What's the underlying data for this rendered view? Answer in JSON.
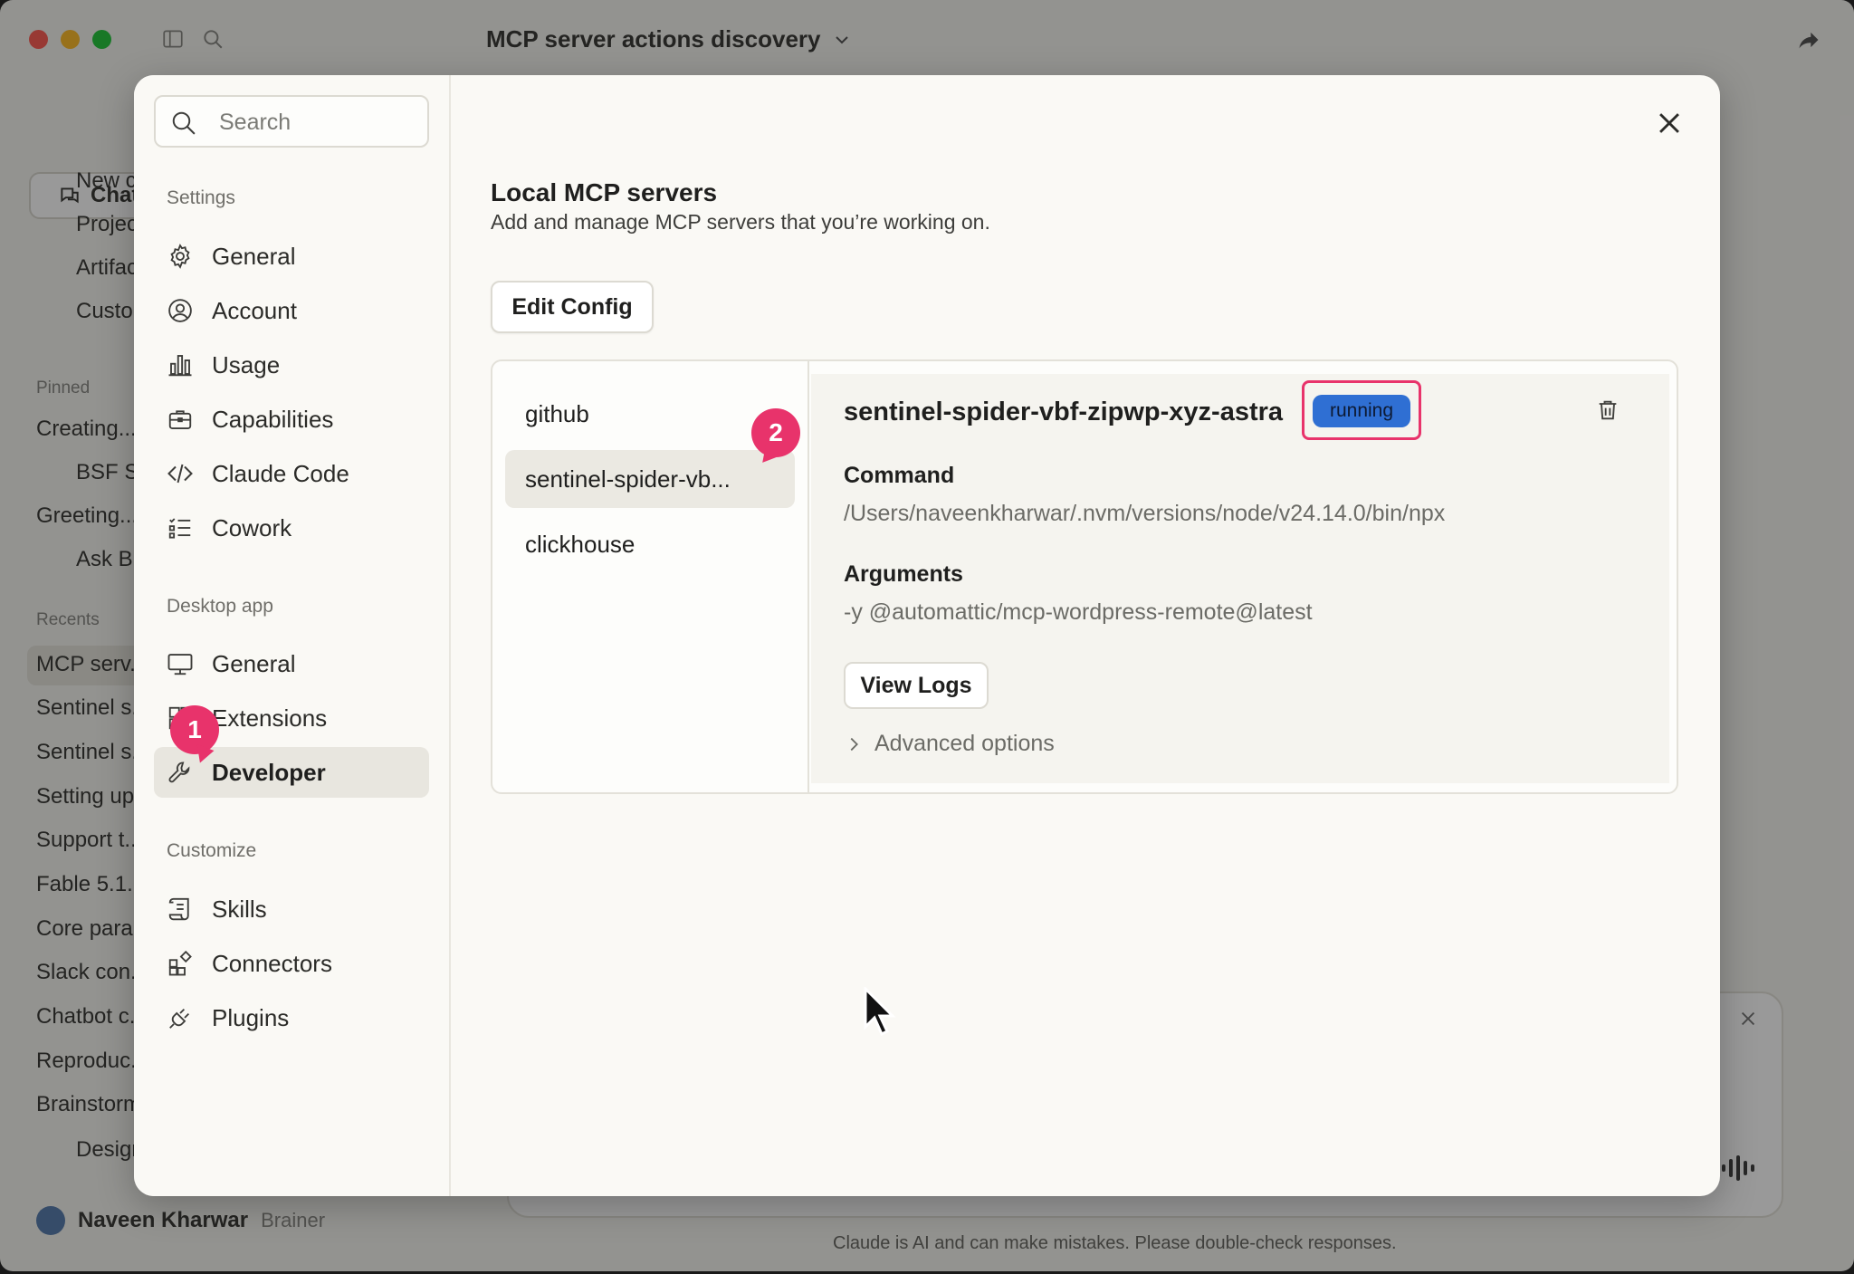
{
  "background": {
    "chat_title": "MCP server actions discovery",
    "chat_button": "Chat",
    "sidebar_items": [
      "New chat",
      "Projects",
      "Artifacts",
      "Customize"
    ],
    "pinned_label": "Pinned",
    "pinned_items": [
      "Creating...",
      "BSF S...",
      "Greeting...",
      "Ask B..."
    ],
    "recents_label": "Recents",
    "recent_items": [
      "MCP serv...",
      "Sentinel s...",
      "Sentinel s...",
      "Setting up...",
      "Support t...",
      "Fable 5.1...",
      "Core para...",
      "Slack con...",
      "Chatbot c...",
      "Reproduc...",
      "Brainstorm...",
      "Design..."
    ],
    "user_name": "Naveen Kharwar",
    "user_plan": "Brainer",
    "disclaimer": "Claude is AI and can make mistakes. Please double-check responses."
  },
  "nav": {
    "search_placeholder": "Search",
    "settings_label": "Settings",
    "settings_items": [
      {
        "label": "General",
        "icon": "gear-icon"
      },
      {
        "label": "Account",
        "icon": "account-icon"
      },
      {
        "label": "Usage",
        "icon": "usage-icon"
      },
      {
        "label": "Capabilities",
        "icon": "briefcase-icon"
      },
      {
        "label": "Claude Code",
        "icon": "code-icon"
      },
      {
        "label": "Cowork",
        "icon": "list-icon"
      }
    ],
    "desktop_label": "Desktop app",
    "desktop_items": [
      {
        "label": "General",
        "icon": "monitor-icon"
      },
      {
        "label": "Extensions",
        "icon": "extensions-icon"
      },
      {
        "label": "Developer",
        "icon": "wrench-icon"
      }
    ],
    "customize_label": "Customize",
    "customize_items": [
      {
        "label": "Skills",
        "icon": "scroll-icon"
      },
      {
        "label": "Connectors",
        "icon": "connectors-icon"
      },
      {
        "label": "Plugins",
        "icon": "plug-icon"
      }
    ],
    "step_badges": [
      "1",
      "2"
    ]
  },
  "content": {
    "title": "Local MCP servers",
    "subtitle": "Add and manage MCP servers that you’re working on.",
    "edit_config_label": "Edit Config",
    "servers": [
      "github",
      "sentinel-spider-vb...",
      "clickhouse"
    ],
    "selected": {
      "name": "sentinel-spider-vbf-zipwp-xyz-astra",
      "status": "running",
      "command_label": "Command",
      "command_value": "/Users/naveenkharwar/.nvm/versions/node/v24.14.0/bin/npx",
      "arguments_label": "Arguments",
      "arguments_value": "-y @automattic/mcp-wordpress-remote@latest",
      "view_logs_label": "View Logs",
      "advanced_label": "Advanced options"
    }
  },
  "colors": {
    "accent_badge": "#e8336b",
    "status_running": "#2f6fd3",
    "modal_bg": "#faf9f5"
  }
}
